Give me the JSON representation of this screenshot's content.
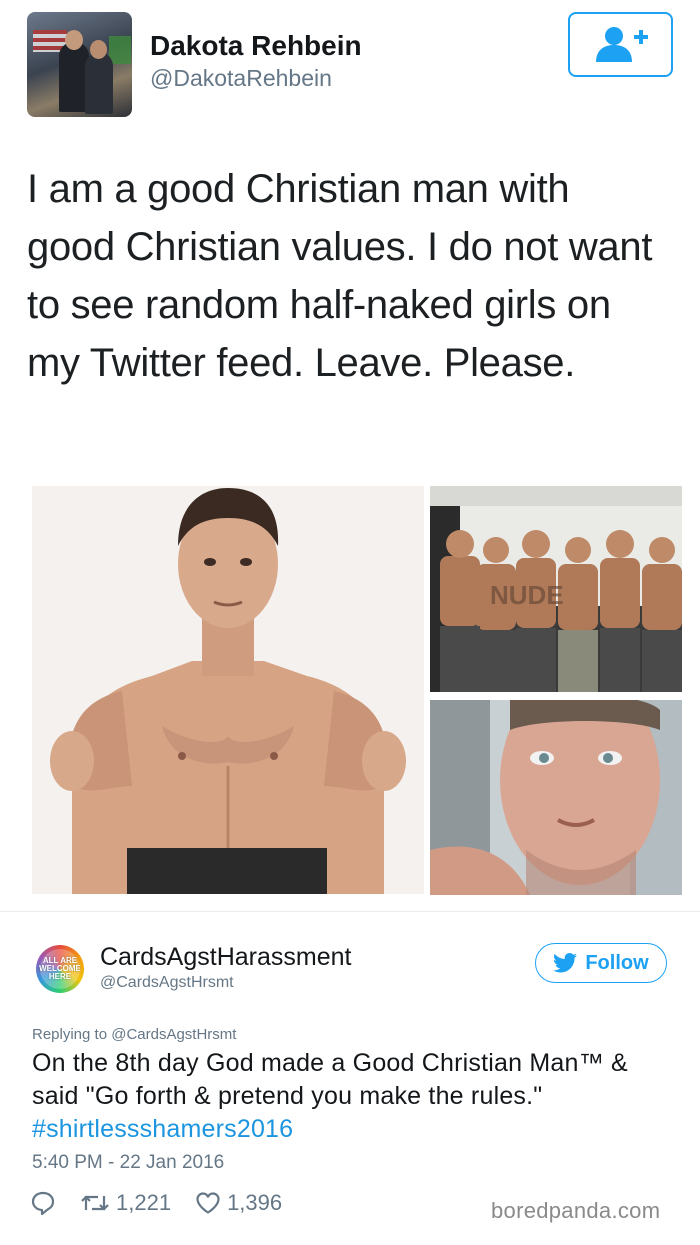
{
  "tweet1": {
    "author_name": "Dakota Rehbein",
    "author_handle": "@DakotaRehbein",
    "text": "I am a good Christian man with good Christian values. I do not want to see random half-naked girls on my Twitter feed. Leave. Please.",
    "follow_icon": "add-user-icon",
    "photo_group_overlay_text": "NUDE"
  },
  "tweet2": {
    "avatar_text": [
      "ALL ARE",
      "WELCOME",
      "HERE"
    ],
    "author_name": "CardsAgstHarassment",
    "author_handle": "@CardsAgstHrsmt",
    "follow_label": "Follow",
    "reply_to": "Replying to @CardsAgstHrsmt",
    "text": "On the 8th day God made a Good Christian Man™ & said \"Go forth & pretend you make the rules.\"",
    "hashtag": "#shirtlessshamers2016",
    "timestamp": "5:40 PM - 22 Jan 2016",
    "retweets": "1,221",
    "likes": "1,396"
  },
  "watermark": "boredpanda.com",
  "colors": {
    "accent": "#1da1f2",
    "hashtag": "#1b95e0",
    "muted": "#657786"
  }
}
